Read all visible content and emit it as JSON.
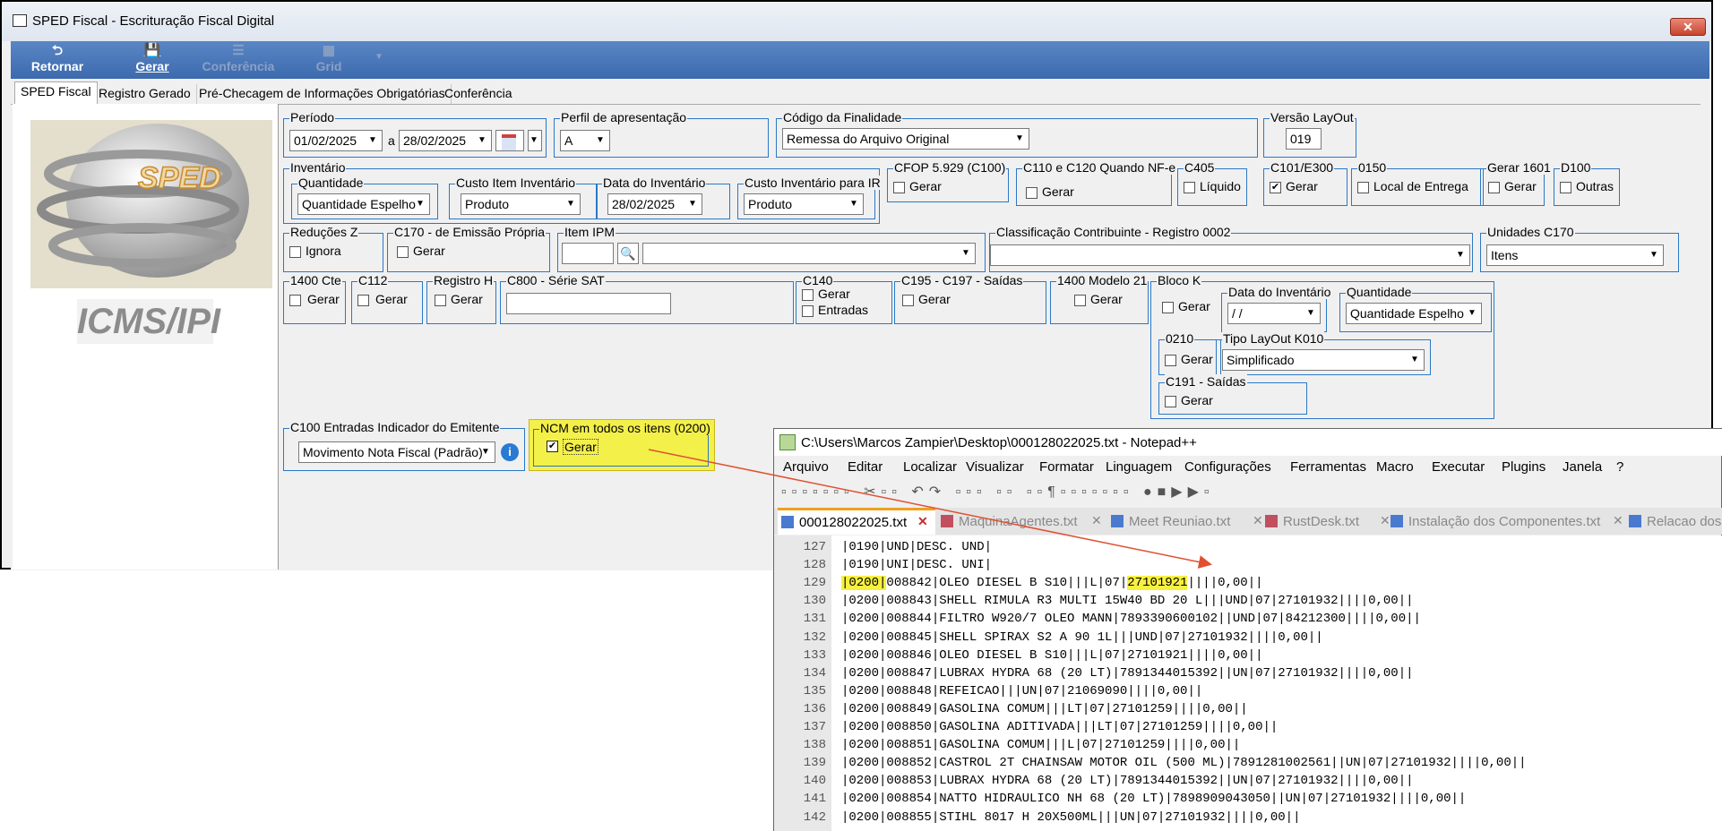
{
  "window": {
    "title": "SPED Fiscal - Escrituração Fiscal Digital",
    "close": "✕"
  },
  "toolbar": {
    "retornar": "Retornar",
    "gerar": "Gerar",
    "conferencia": "Conferência",
    "grid": "Grid"
  },
  "tabs": [
    "SPED Fiscal",
    "Registro Gerado",
    "Pré-Checagem de Informações Obrigatórias",
    "Conferência"
  ],
  "logo": {
    "text": "SPED",
    "subtitle": "ICMS/IPI"
  },
  "periodo": {
    "label": "Período",
    "from": "01/02/2025",
    "sep": "a",
    "to": "28/02/2025"
  },
  "perfil": {
    "label": "Perfil de apresentação",
    "value": "A"
  },
  "finalidade": {
    "label": "Código da Finalidade",
    "value": "Remessa do Arquivo Original"
  },
  "versao": {
    "label": "Versão LayOut",
    "value": "019"
  },
  "inventario": {
    "label": "Inventário",
    "quantidade_label": "Quantidade",
    "quantidade": "Quantidade Espelho",
    "custo_label": "Custo Item Inventário",
    "custo": "Produto",
    "data_label": "Data do Inventário",
    "data": "28/02/2025",
    "ir_label": "Custo Inventário para IR",
    "ir": "Produto"
  },
  "cfop": {
    "label": "CFOP 5.929 (C100)",
    "cb": "Gerar"
  },
  "c110": {
    "label": "C110 e C120 Quando NF-e",
    "cb": "Gerar"
  },
  "c405": {
    "label": "C405",
    "cb": "Líquido"
  },
  "c101": {
    "label": "C101/E300",
    "cb": "Gerar"
  },
  "r0150": {
    "label": "0150",
    "cb": "Local de Entrega"
  },
  "g1601": {
    "label": "Gerar 1601",
    "cb": "Gerar"
  },
  "d100": {
    "label": "D100",
    "cb": "Outras"
  },
  "reducoes": {
    "label": "Reduções Z",
    "cb": "Ignora"
  },
  "c170": {
    "label": "C170 - de Emissão Própria",
    "cb": "Gerar"
  },
  "itemipm": {
    "label": "Item IPM"
  },
  "classif": {
    "label": "Classificação Contribuinte - Registro 0002"
  },
  "unidades": {
    "label": "Unidades C170",
    "value": "Itens"
  },
  "cte1400": {
    "label": "1400 Cte",
    "cb": "Gerar"
  },
  "c112": {
    "label": "C112",
    "cb": "Gerar"
  },
  "regh": {
    "label": "Registro H",
    "cb": "Gerar"
  },
  "c800": {
    "label": "C800 - Série SAT"
  },
  "c140": {
    "label": "C140",
    "cb1": "Gerar",
    "cb2": "Entradas"
  },
  "c195": {
    "label": "C195 - C197 - Saídas",
    "cb": "Gerar"
  },
  "m21": {
    "label": "1400 Modelo 21",
    "cb": "Gerar"
  },
  "blocok": {
    "label": "Bloco K",
    "cb": "Gerar",
    "data_label": "Data do Inventário",
    "data": " / /",
    "qtd_label": "Quantidade",
    "qtd": "Quantidade Espelho",
    "r0210_label": "0210",
    "r0210_cb": "Gerar",
    "tipo_label": "Tipo LayOut K010",
    "tipo": "Simplificado",
    "c191_label": "C191 - Saídas",
    "c191_cb": "Gerar"
  },
  "c100ent": {
    "label": "C100 Entradas Indicador do Emitente",
    "value": "Movimento Nota Fiscal (Padrão)"
  },
  "ncm": {
    "label": "NCM em todos os itens (0200)",
    "cb": "Gerar"
  },
  "notepad": {
    "title": "C:\\Users\\Marcos Zampier\\Desktop\\000128022025.txt - Notepad++",
    "menu": [
      "Arquivo",
      "Editar",
      "Localizar",
      "Visualizar",
      "Formatar",
      "Linguagem",
      "Configurações",
      "Ferramentas",
      "Macro",
      "Executar",
      "Plugins",
      "Janela",
      "?"
    ],
    "tabs": [
      "000128022025.txt",
      "MaquinaAgentes.txt",
      "Meet Reuniao.txt",
      "RustDesk.txt",
      "Instalação dos Componentes.txt",
      "Relacao dos"
    ],
    "lines": [
      {
        "n": "127",
        "t": "|0190|UND|DESC. UND|"
      },
      {
        "n": "128",
        "t": "|0190|UNI|DESC. UNI|"
      },
      {
        "n": "129",
        "a": "|0200|",
        "b": "008842|OLEO DIESEL B S10|||L|07|",
        "c": "27101921",
        "d": "||||0,00||"
      },
      {
        "n": "130",
        "t": "|0200|008843|SHELL RIMULA R3 MULTI 15W40 BD 20 L|||UND|07|27101932||||0,00||"
      },
      {
        "n": "131",
        "t": "|0200|008844|FILTRO W920/7 OLEO MANN|7893390600102||UND|07|84212300||||0,00||"
      },
      {
        "n": "132",
        "t": "|0200|008845|SHELL SPIRAX S2 A 90 1L|||UND|07|27101932||||0,00||"
      },
      {
        "n": "133",
        "t": "|0200|008846|OLEO DIESEL B S10|||L|07|27101921||||0,00||"
      },
      {
        "n": "134",
        "t": "|0200|008847|LUBRAX HYDRA 68 (20 LT)|7891344015392||UN|07|27101932||||0,00||"
      },
      {
        "n": "135",
        "t": "|0200|008848|REFEICAO|||UN|07|21069090||||0,00||"
      },
      {
        "n": "136",
        "t": "|0200|008849|GASOLINA COMUM|||LT|07|27101259||||0,00||"
      },
      {
        "n": "137",
        "t": "|0200|008850|GASOLINA ADITIVADA|||LT|07|27101259||||0,00||"
      },
      {
        "n": "138",
        "t": "|0200|008851|GASOLINA COMUM|||L|07|27101259||||0,00||"
      },
      {
        "n": "139",
        "t": "|0200|008852|CASTROL 2T CHAINSAW MOTOR OIL (500 ML)|7891281002561||UN|07|27101932||||0,00||"
      },
      {
        "n": "140",
        "t": "|0200|008853|LUBRAX HYDRA 68 (20 LT)|7891344015392||UN|07|27101932||||0,00||"
      },
      {
        "n": "141",
        "t": "|0200|008854|NATTO HIDRAULICO NH 68 (20 LT)|7898909043050||UN|07|27101932||||0,00||"
      },
      {
        "n": "142",
        "t": "|0200|008855|STIHL 8017 H 20X500ML|||UN|07|27101932||||0,00||"
      }
    ]
  }
}
